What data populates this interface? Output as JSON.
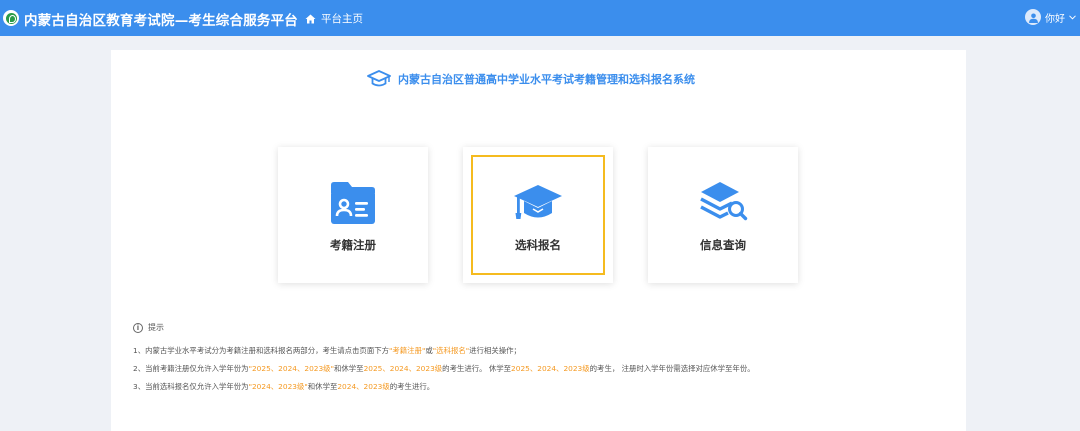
{
  "header": {
    "site_title": "内蒙古自治区教育考试院—考生综合服务平台",
    "home_label": "平台主页",
    "user_greeting": "你好",
    "colors": {
      "bar": "#3b8eed",
      "accent": "#f59a23",
      "card_active": "#f5bb1f"
    }
  },
  "main": {
    "system_title": "内蒙古自治区普通高中学业水平考试考籍管理和选科报名系统",
    "cards": [
      {
        "label": "考籍注册",
        "icon": "id-folder-icon",
        "active": false
      },
      {
        "label": "选科报名",
        "icon": "graduation-cap-icon",
        "active": true
      },
      {
        "label": "信息查询",
        "icon": "layers-search-icon",
        "active": false
      }
    ]
  },
  "tips": {
    "heading": "提示",
    "line1": {
      "a": "1、内蒙古学业水平考试分为考籍注册和选科报名两部分，考生请点击页面下方",
      "h1": "\"考籍注册\"",
      "b": "或",
      "h2": "\"选科报名\"",
      "c": "进行相关操作；"
    },
    "line2": {
      "a": "2、当前考籍注册仅允许入学年份为",
      "h1": "\"2025、2024、2023级\"",
      "b": "和休学至",
      "h2": "2025、2024、2023级",
      "c": "的考生进行。 休学至",
      "h3": "2025、2024、2023级",
      "d": "的考生， 注册时入学年份需选择对应休学至年份。"
    },
    "line3": {
      "a": "3、当前选科报名仅允许入学年份为",
      "h1": "\"2024、2023级\"",
      "b": "和休学至",
      "h2": "2024、2023级",
      "c": "的考生进行。"
    }
  }
}
